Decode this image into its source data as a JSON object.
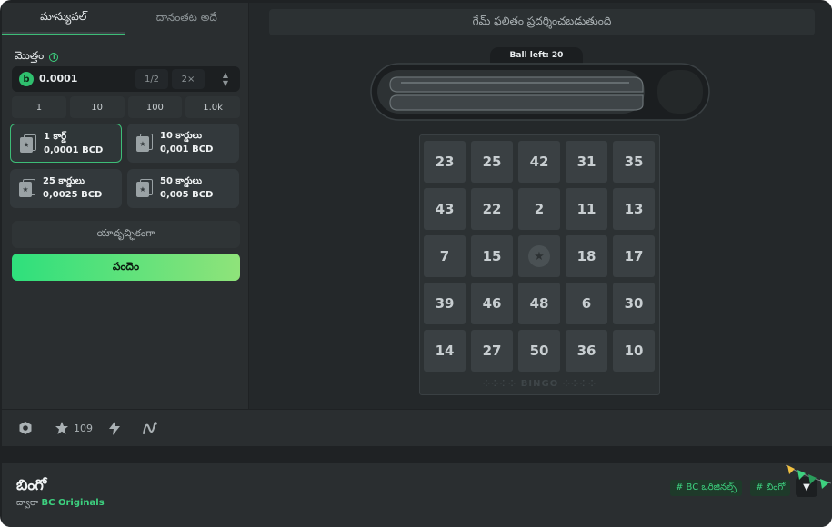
{
  "tabs": [
    {
      "label": "మాన్యువల్",
      "active": true
    },
    {
      "label": "దానంతట అదే",
      "active": false
    }
  ],
  "amount": {
    "label": "మొత్తం",
    "value": "0.0001",
    "half": "1/2",
    "double": "2×"
  },
  "quick_amounts": [
    "1",
    "10",
    "100",
    "1.0k"
  ],
  "card_options": [
    {
      "title": "1 కార్డ్",
      "price": "0,0001 BCD",
      "selected": true
    },
    {
      "title": "10 కార్డులు",
      "price": "0,001 BCD",
      "selected": false
    },
    {
      "title": "25 కార్డులు",
      "price": "0,0025 BCD",
      "selected": false
    },
    {
      "title": "50 కార్డులు",
      "price": "0,005 BCD",
      "selected": false
    }
  ],
  "random_label": "యాదృచ్ఛికంగా",
  "bet_label": "పందెం",
  "game_result": "గేమ్ ఫలితం ప్రదర్శించబడుతుంది",
  "ball_left": "Ball left: 20",
  "board": {
    "rows": [
      [
        "23",
        "25",
        "42",
        "31",
        "35"
      ],
      [
        "43",
        "22",
        "2",
        "11",
        "13"
      ],
      [
        "7",
        "15",
        "★",
        "18",
        "17"
      ],
      [
        "39",
        "46",
        "48",
        "6",
        "30"
      ],
      [
        "14",
        "27",
        "50",
        "36",
        "10"
      ]
    ],
    "footer": "⁘⁘⁘⁘ BINGO ⁘⁘⁘⁘"
  },
  "toolbar": {
    "favorites_count": "109",
    "icons": [
      "hexagon-icon",
      "star-icon",
      "lightning-icon",
      "chart-icon"
    ]
  },
  "footer": {
    "title": "బింగో",
    "by_label": "ద్వారా",
    "provider": "BC Originals",
    "tags": [
      "# BC ఒరిజినల్స్",
      "# బింగో"
    ]
  },
  "colors": {
    "accent": "#3dd17f",
    "bet_gradient_start": "#2ee07c",
    "bet_gradient_end": "#8fe37a"
  }
}
